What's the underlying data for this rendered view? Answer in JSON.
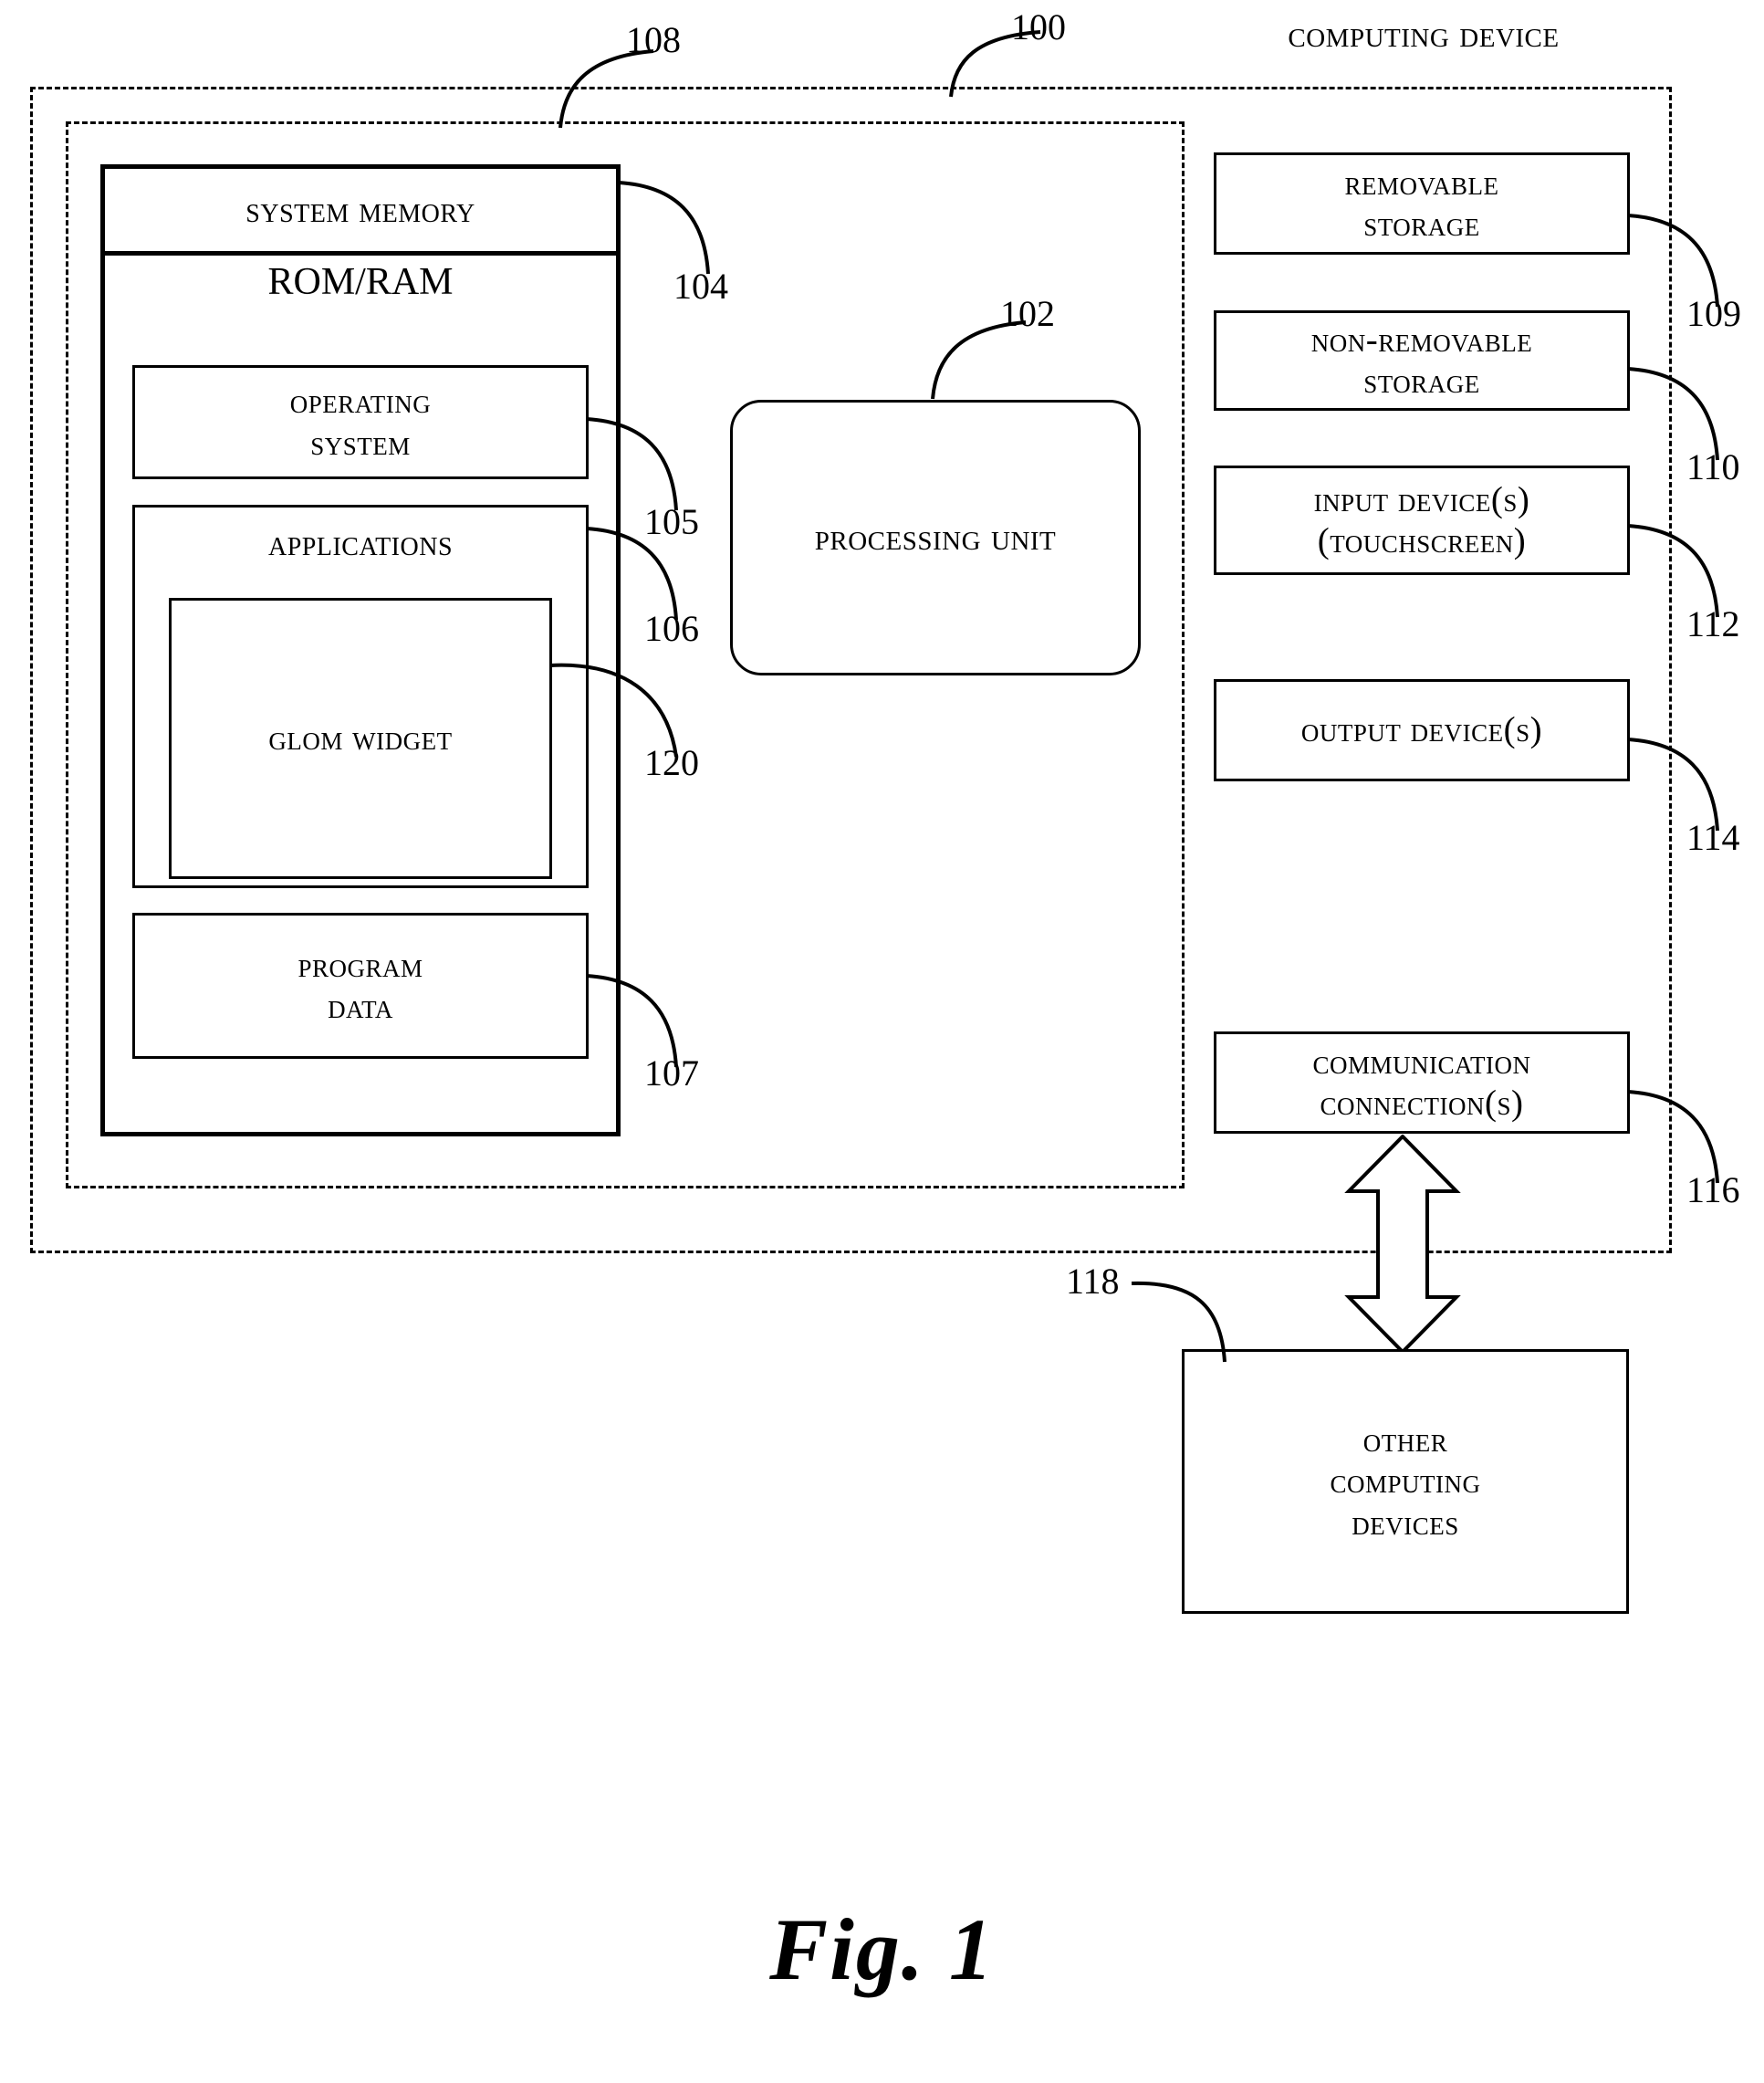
{
  "figure": {
    "caption": "Fig. 1",
    "title": "Computing Device"
  },
  "frames": {
    "outer_ref": "100",
    "inner_ref": "108"
  },
  "memory": {
    "title": "System Memory",
    "subtitle": "ROM/RAM",
    "ref": "104",
    "items": [
      {
        "label_line1": "Operating",
        "label_line2": "System",
        "ref": "105"
      },
      {
        "label_line1": "Applications",
        "ref": "106"
      },
      {
        "label_line1": "Glom Widget",
        "ref": "120"
      },
      {
        "label_line1": "Program",
        "label_line2": "Data",
        "ref": "107"
      }
    ]
  },
  "processing_unit": {
    "label": "Processing Unit",
    "ref": "102"
  },
  "peripherals": [
    {
      "line1": "Removable",
      "line2": "Storage",
      "ref": "109"
    },
    {
      "line1": "Non-Removable",
      "line2": "Storage",
      "ref": "110"
    },
    {
      "line1": "Input Device(s)",
      "line2": "(Touchscreen)",
      "ref": "112"
    },
    {
      "line1": "Output Device(s)",
      "line2": "",
      "ref": "114"
    },
    {
      "line1": "Communication",
      "line2": "Connection(s)",
      "ref": "116"
    }
  ],
  "other_devices": {
    "line1": "Other",
    "line2": "Computing",
    "line3": "Devices",
    "ref": "118"
  },
  "colors": {
    "stroke": "#000000",
    "background": "#ffffff"
  },
  "icons": {
    "comm_arrow": "double-headed-vertical-arrow-icon"
  }
}
